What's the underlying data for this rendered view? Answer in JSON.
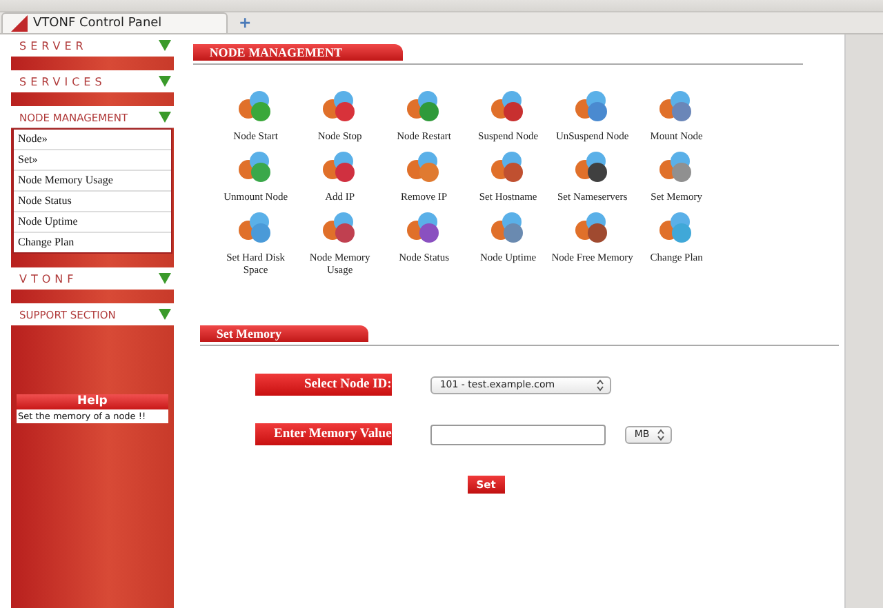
{
  "browser": {
    "tab_title": "VTONF Control Panel",
    "new_tab": "+"
  },
  "sidebar": {
    "sections": [
      {
        "title": "SERVER",
        "spaced": true,
        "expanded": false
      },
      {
        "title": "SERVICES",
        "spaced": true,
        "expanded": false
      },
      {
        "title": "NODE MANAGEMENT",
        "spaced": false,
        "expanded": true,
        "items": [
          "Node»",
          "Set»",
          "Node Memory Usage",
          "Node Status",
          "Node Uptime",
          "Change Plan"
        ]
      },
      {
        "title": "VTONF",
        "spaced": true,
        "expanded": false
      },
      {
        "title": "SUPPORT SECTION",
        "spaced": false,
        "expanded": false
      }
    ],
    "help": {
      "title": "Help",
      "text": "Set the memory of a node !!"
    }
  },
  "main": {
    "heading": "NODE MANAGEMENT",
    "actions": [
      {
        "label": "Node Start",
        "color": "#3aa83a"
      },
      {
        "label": "Node Stop",
        "color": "#d8323a"
      },
      {
        "label": "Node Restart",
        "color": "#2f9a3a"
      },
      {
        "label": "Suspend Node",
        "color": "#c83030"
      },
      {
        "label": "UnSuspend Node",
        "color": "#4a8ad0"
      },
      {
        "label": "Mount Node",
        "color": "#6a86b8"
      },
      {
        "label": "Unmount Node",
        "color": "#3aa84a"
      },
      {
        "label": "Add IP",
        "color": "#d03040"
      },
      {
        "label": "Remove IP",
        "color": "#e07a30"
      },
      {
        "label": "Set Hostname",
        "color": "#c05030"
      },
      {
        "label": "Set Nameservers",
        "color": "#404040"
      },
      {
        "label": "Set Memory",
        "color": "#909090"
      },
      {
        "label": "Set Hard Disk Space",
        "color": "#4a9ad8"
      },
      {
        "label": "Node Memory Usage",
        "color": "#c04050"
      },
      {
        "label": "Node Status",
        "color": "#8a50c0"
      },
      {
        "label": "Node Uptime",
        "color": "#6a8ab0"
      },
      {
        "label": "Node Free Memory",
        "color": "#a04a30"
      },
      {
        "label": "Change Plan",
        "color": "#40a8d8"
      }
    ],
    "form": {
      "heading": "Set Memory",
      "node_label": "Select Node ID:",
      "node_value": "101 - test.example.com",
      "memory_label": "Enter Memory Value",
      "unit": "MB",
      "submit": "Set"
    }
  }
}
